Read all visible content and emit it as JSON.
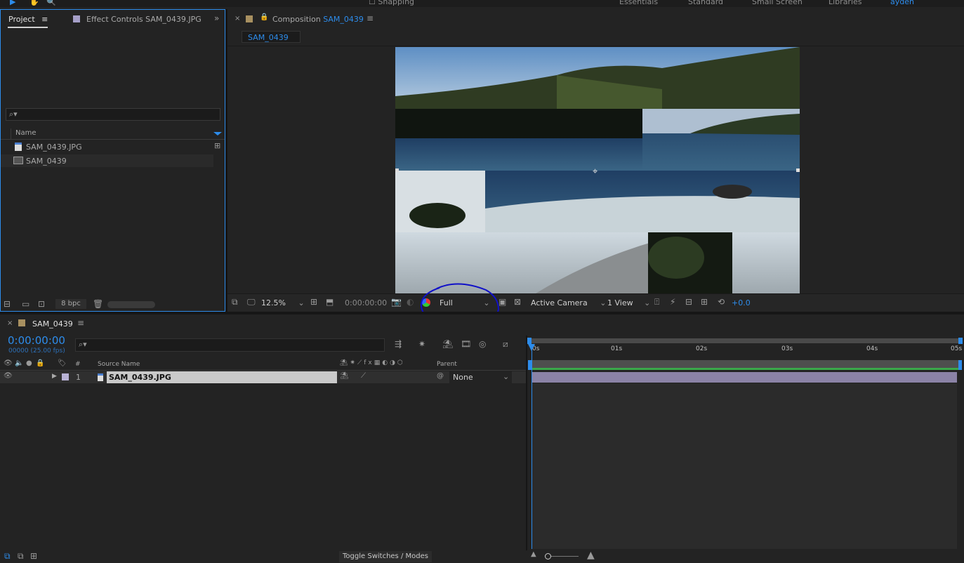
{
  "toolbar": {
    "snapping_label": "Snapping",
    "workspaces": [
      "Essentials",
      "Standard",
      "Small Screen",
      "Libraries"
    ],
    "active_workspace": "ayden"
  },
  "project_panel": {
    "tab_project": "Project",
    "tab_effect_controls": "Effect Controls SAM_0439.JPG",
    "search_placeholder": "",
    "column_name": "Name",
    "items": [
      {
        "name": "SAM_0439.JPG",
        "type": "image"
      },
      {
        "name": "SAM_0439",
        "type": "composition"
      }
    ],
    "bpc": "8 bpc"
  },
  "composition_panel": {
    "tab_prefix": "Composition",
    "tab_name": "SAM_0439",
    "subtab": "SAM_0439",
    "zoom": "12.5%",
    "timecode": "0:00:00:00",
    "resolution": "Full",
    "camera": "Active Camera",
    "views": "1 View",
    "exposure": "+0.0"
  },
  "timeline_panel": {
    "tab_name": "SAM_0439",
    "timecode": "0:00:00:00",
    "frame_info": "00000 (25.00 fps)",
    "col_num": "#",
    "col_source": "Source Name",
    "col_parent": "Parent",
    "layer": {
      "index": "1",
      "name": "SAM_0439.JPG",
      "parent": "None"
    },
    "ruler": [
      "0s",
      "01s",
      "02s",
      "03s",
      "04s",
      "05s"
    ],
    "toggle_label": "Toggle Switches / Modes"
  },
  "colors": {
    "accent": "#2d8ceb",
    "annotation": "#1010c8",
    "work_area": "#3aa84a",
    "layer_bar": "#8b83a6"
  }
}
